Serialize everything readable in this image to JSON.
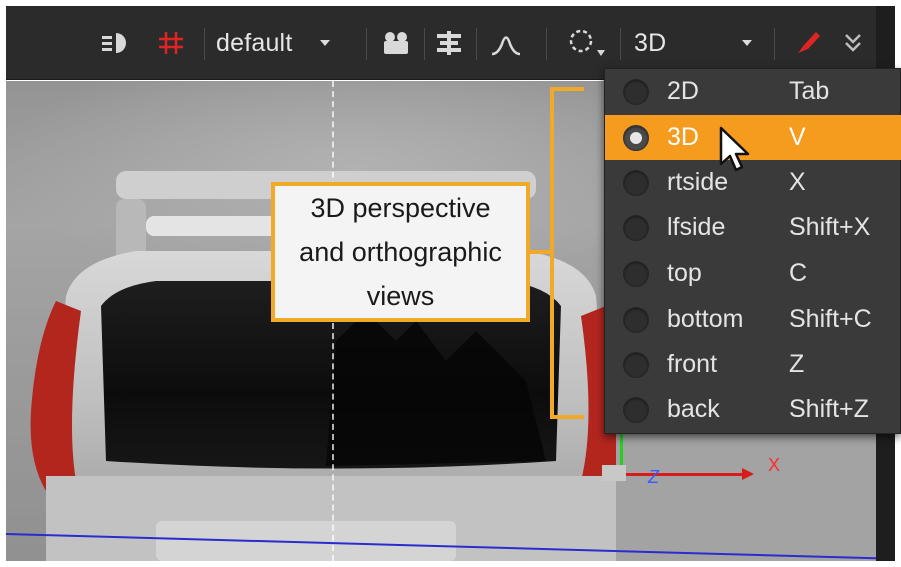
{
  "toolbar": {
    "preset_value": "default",
    "view_mode_value": "3D"
  },
  "view_menu": {
    "items": [
      {
        "label": "2D",
        "shortcut": "Tab",
        "selected": false
      },
      {
        "label": "3D",
        "shortcut": "V",
        "selected": true
      },
      {
        "label": "rtside",
        "shortcut": "X",
        "selected": false
      },
      {
        "label": "lfside",
        "shortcut": "Shift+X",
        "selected": false
      },
      {
        "label": "top",
        "shortcut": "C",
        "selected": false
      },
      {
        "label": "bottom",
        "shortcut": "Shift+C",
        "selected": false
      },
      {
        "label": "front",
        "shortcut": "Z",
        "selected": false
      },
      {
        "label": "back",
        "shortcut": "Shift+Z",
        "selected": false
      }
    ]
  },
  "callout": {
    "line1": "3D perspective",
    "line2": "and orthographic",
    "line3": "views"
  },
  "viewer": {
    "axis_x_label": "X",
    "axis_z_label": "Z"
  },
  "colors": {
    "toolbar_bg": "#2b2b2b",
    "menu_bg": "#3a3a3a",
    "selection": "#f59b1d",
    "callout_border": "#f0a928",
    "axis_red": "#d81c1c",
    "axis_green": "#25d025",
    "axis_blue": "#2b2bd0"
  }
}
